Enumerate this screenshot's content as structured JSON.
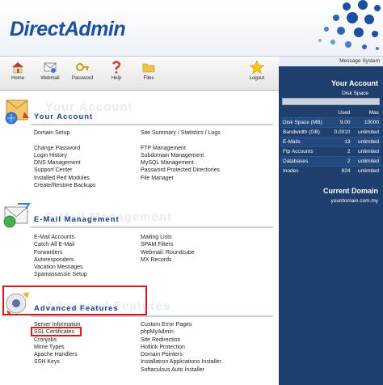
{
  "app": {
    "logo_text": "DirectAdmin"
  },
  "toolbar": [
    {
      "key": "home",
      "label": "Home",
      "icon": "home-icon"
    },
    {
      "key": "webmail",
      "label": "Webmail",
      "icon": "webmail-icon"
    },
    {
      "key": "password",
      "label": "Password",
      "icon": "password-icon"
    },
    {
      "key": "help",
      "label": "Help",
      "icon": "help-icon"
    },
    {
      "key": "files",
      "label": "Files",
      "icon": "folder-icon"
    },
    {
      "key": "logout",
      "label": "Logout",
      "icon": "star-icon"
    }
  ],
  "right_panel": {
    "message_system": "Message System",
    "your_account": "Your Account",
    "disk_space_label": "Disk Space",
    "columns": [
      "Used",
      "Max"
    ],
    "stats": [
      {
        "name": "Disk Space (MB)",
        "used": "9.00",
        "max": "10000"
      },
      {
        "name": "Bandwidth (GB)",
        "used": "0.0010",
        "max": "unlimited"
      },
      {
        "name": "E-Mails",
        "used": "13",
        "max": "unlimited"
      },
      {
        "name": "Ftp Accounts",
        "used": "2",
        "max": "unlimited"
      },
      {
        "name": "Databases",
        "used": "2",
        "max": "unlimited"
      },
      {
        "name": "Inodes",
        "used": "824",
        "max": "unlimited"
      }
    ],
    "current_domain_label": "Current Domain",
    "current_domain": "yourdomain.com.my"
  },
  "sections": {
    "your_account": {
      "title": "Your Account",
      "ghost": "Your Account",
      "left": [
        "Domain Setup",
        "",
        "Change Password",
        "Login History",
        "DNS Management",
        "Support Center",
        "Installed Perl Modules",
        "Create/Restore Backups"
      ],
      "right": [
        "Site Summary / Statistics / Logs",
        "",
        "FTP Management",
        "Subdomain Management",
        "MySQL Management",
        "Password Protected Directories",
        "File Manager"
      ]
    },
    "email": {
      "title": "E-Mail Management",
      "ghost": "E-Mail Management",
      "left": [
        "E-Mail Accounts",
        "Catch-All E-Mail",
        "Forwarders",
        "Autoresponders",
        "Vacation Messages",
        "Spamassassin Setup"
      ],
      "right": [
        "Mailing Lists",
        "SPAM Filters",
        "Webmail: Roundcube",
        "MX Records"
      ]
    },
    "advanced": {
      "title": "Advanced Features",
      "ghost": "Advanced Features",
      "left": [
        "Server Information",
        "SSL Certificates",
        "Cronjobs",
        "Mime Types",
        "Apache Handlers",
        "SSH Keys"
      ],
      "right": [
        "Custom Error Pages",
        "phpMyAdmin",
        "Site Redirection",
        "Hotlink Protection",
        "Domain Pointers",
        "Installatron Applications Installer",
        "Softaculous Auto Installer"
      ]
    }
  },
  "colors": {
    "accent": "#1b3f8a",
    "panel": "#1f3f6e",
    "highlight": "#e0151b"
  }
}
